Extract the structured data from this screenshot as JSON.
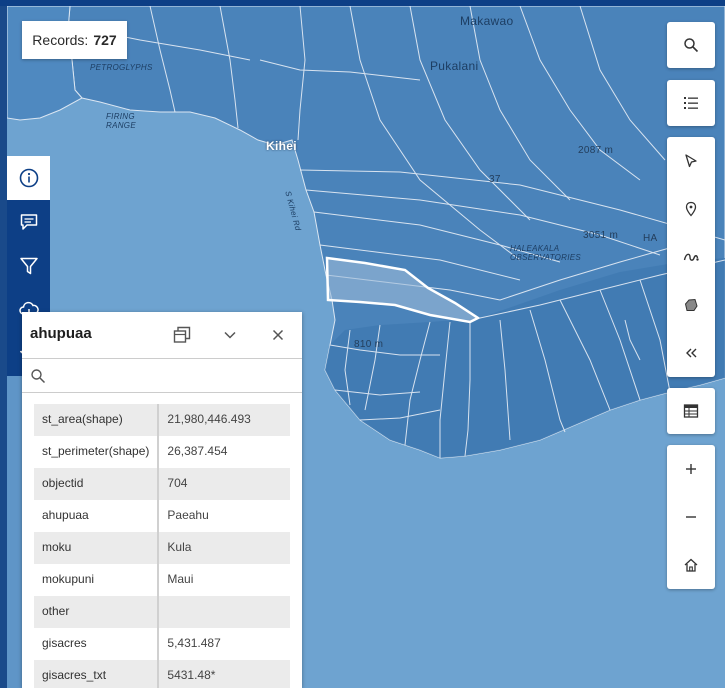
{
  "records": {
    "label": "Records:",
    "count": "727"
  },
  "map_labels": {
    "makawao": "Makawao",
    "pukalani": "Pukalani",
    "kihei": "Kihei",
    "elev_2087": "2087 m",
    "elev_37": "37",
    "elev_3051": "3051 m",
    "elev_810": "810 m",
    "firing_range": "FIRING RANGE",
    "petroglyphs": "PETROGLYPHS",
    "haleakala_obs": "HALEAKALA OBSERVATORIES",
    "ha": "HA",
    "south_kihei_rd": "S Kihei Rd"
  },
  "left_toolbar": {
    "items": [
      {
        "icon": "info-icon",
        "active": true
      },
      {
        "icon": "comment-icon",
        "active": false
      },
      {
        "icon": "filter-icon",
        "active": false
      },
      {
        "icon": "cloud-download-icon",
        "active": false
      },
      {
        "icon": "star-icon",
        "active": false
      }
    ]
  },
  "panel": {
    "title": "ahupuaa",
    "rows": [
      {
        "key": "st_area(shape)",
        "value": "21,980,446.493"
      },
      {
        "key": "st_perimeter(shape)",
        "value": "26,387.454"
      },
      {
        "key": "objectid",
        "value": "704"
      },
      {
        "key": "ahupuaa",
        "value": "Paeahu"
      },
      {
        "key": "moku",
        "value": "Kula"
      },
      {
        "key": "mokupuni",
        "value": "Maui"
      },
      {
        "key": "other",
        "value": ""
      },
      {
        "key": "gisacres",
        "value": "5,431.487"
      },
      {
        "key": "gisacres_txt",
        "value": "5431.48*"
      }
    ]
  },
  "right_toolbar": {
    "search": "search-icon",
    "layers": "layer-list-icon",
    "select": "select-arrow-icon",
    "point": "draw-point-icon",
    "polyline": "draw-polyline-icon",
    "polygon": "draw-polygon-icon",
    "collapse": "collapse-icon",
    "table": "table-icon",
    "zoom_in": "zoom-in-icon",
    "zoom_out": "zoom-out-icon",
    "home": "home-icon"
  },
  "colors": {
    "toolbar": "#0d3f86",
    "ocean": "#6a9fcd",
    "land": "#4a82b9",
    "highlight": "#ffffff"
  }
}
